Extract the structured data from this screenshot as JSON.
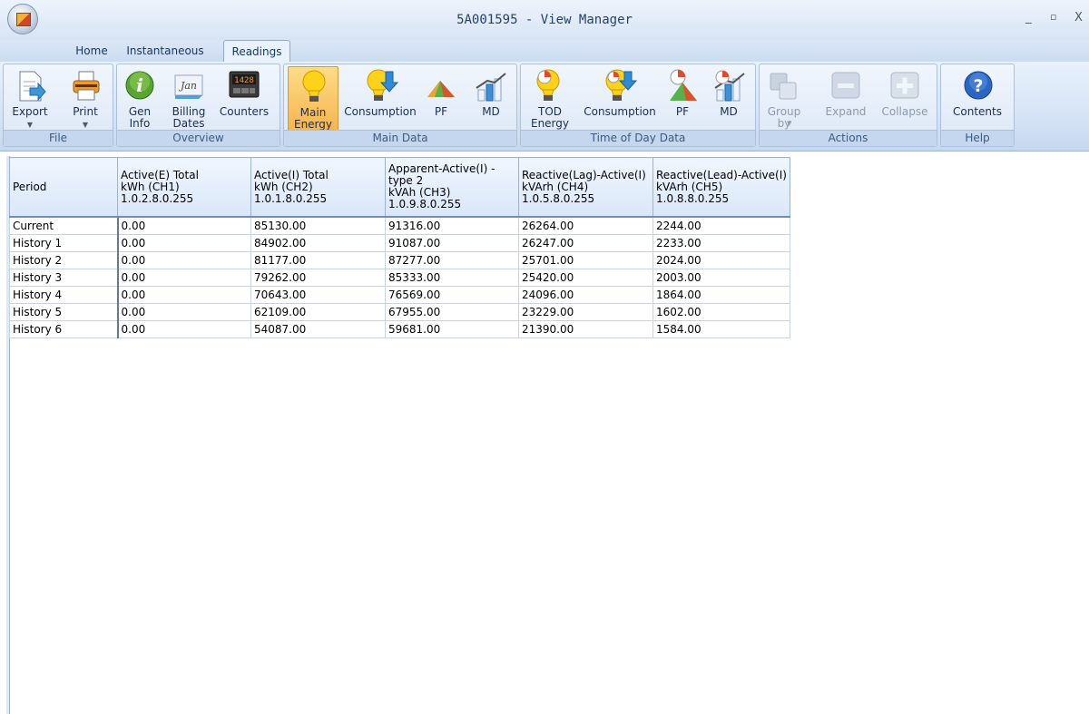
{
  "window": {
    "title": "5A001595 - View Manager",
    "minimize": "_",
    "restore": "▫",
    "close": "X"
  },
  "tabs": [
    {
      "label": "Home"
    },
    {
      "label": "Instantaneous"
    },
    {
      "label": "Readings"
    }
  ],
  "ribbon": {
    "file": {
      "label": "File",
      "export": "Export",
      "print": "Print"
    },
    "overview": {
      "label": "Overview",
      "gen_info": "Gen\nInfo",
      "billing_dates": "Billing\nDates",
      "calendar_text": "Jan",
      "counters": "Counters",
      "counter_digits": "1428"
    },
    "main_data": {
      "label": "Main Data",
      "main_energy": "Main\nEnergy",
      "consumption": "Consumption",
      "pf": "PF",
      "md": "MD"
    },
    "tod_data": {
      "label": "Time of Day Data",
      "tod_energy": "TOD\nEnergy",
      "consumption": "Consumption",
      "pf": "PF",
      "md": "MD"
    },
    "actions": {
      "label": "Actions",
      "group_by": "Group\nby",
      "expand": "Expand",
      "collapse": "Collapse"
    },
    "help": {
      "label": "Help",
      "contents": "Contents"
    }
  },
  "table": {
    "columns": [
      "Period",
      "Active(E) Total\nkWh (CH1)\n1.0.2.8.0.255",
      "Active(I) Total\nkWh (CH2)\n1.0.1.8.0.255",
      "Apparent-Active(I) -\ntype 2\nkVAh (CH3)\n1.0.9.8.0.255",
      "Reactive(Lag)-Active(I)\nkVArh (CH4)\n1.0.5.8.0.255",
      "Reactive(Lead)-Active(I)\nkVArh (CH5)\n1.0.8.8.0.255"
    ],
    "rows": [
      [
        "Current",
        "0.00",
        "85130.00",
        "91316.00",
        "26264.00",
        "2244.00"
      ],
      [
        "History 1",
        "0.00",
        "84902.00",
        "91087.00",
        "26247.00",
        "2233.00"
      ],
      [
        "History 2",
        "0.00",
        "81177.00",
        "87277.00",
        "25701.00",
        "2024.00"
      ],
      [
        "History 3",
        "0.00",
        "79262.00",
        "85333.00",
        "25420.00",
        "2003.00"
      ],
      [
        "History 4",
        "0.00",
        "70643.00",
        "76569.00",
        "24096.00",
        "1864.00"
      ],
      [
        "History 5",
        "0.00",
        "62109.00",
        "67955.00",
        "23229.00",
        "1602.00"
      ],
      [
        "History 6",
        "0.00",
        "54087.00",
        "59681.00",
        "21390.00",
        "1584.00"
      ]
    ]
  }
}
